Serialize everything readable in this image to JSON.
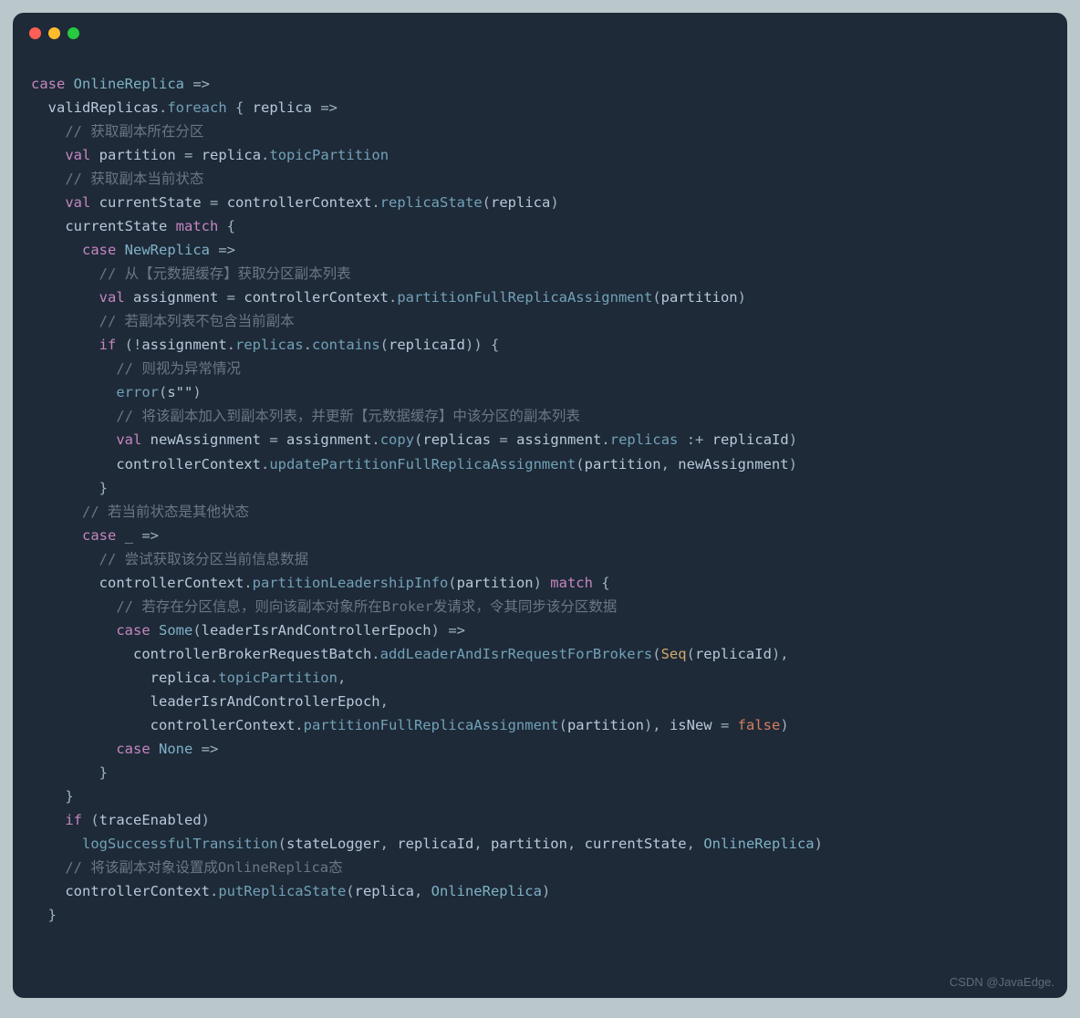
{
  "window": {
    "watermark": "CSDN @JavaEdge."
  },
  "code": {
    "lines": [
      {
        "indent": 0,
        "segments": [
          {
            "t": "case",
            "c": "keyword"
          },
          {
            "t": " ",
            "c": ""
          },
          {
            "t": "OnlineReplica",
            "c": "type"
          },
          {
            "t": " ",
            "c": ""
          },
          {
            "t": "=>",
            "c": "punct"
          }
        ]
      },
      {
        "indent": 1,
        "segments": [
          {
            "t": "validReplicas",
            "c": "ident"
          },
          {
            "t": ".",
            "c": "punct"
          },
          {
            "t": "foreach",
            "c": "method"
          },
          {
            "t": " { ",
            "c": "punct"
          },
          {
            "t": "replica",
            "c": "ident"
          },
          {
            "t": " ",
            "c": ""
          },
          {
            "t": "=>",
            "c": "punct"
          }
        ]
      },
      {
        "indent": 2,
        "segments": [
          {
            "t": "// 获取副本所在分区",
            "c": "comment"
          }
        ]
      },
      {
        "indent": 2,
        "segments": [
          {
            "t": "val",
            "c": "keyword"
          },
          {
            "t": " ",
            "c": ""
          },
          {
            "t": "partition",
            "c": "ident"
          },
          {
            "t": " ",
            "c": ""
          },
          {
            "t": "=",
            "c": "punct"
          },
          {
            "t": " ",
            "c": ""
          },
          {
            "t": "replica",
            "c": "ident"
          },
          {
            "t": ".",
            "c": "punct"
          },
          {
            "t": "topicPartition",
            "c": "method"
          }
        ]
      },
      {
        "indent": 2,
        "segments": [
          {
            "t": "// 获取副本当前状态",
            "c": "comment"
          }
        ]
      },
      {
        "indent": 2,
        "segments": [
          {
            "t": "val",
            "c": "keyword"
          },
          {
            "t": " ",
            "c": ""
          },
          {
            "t": "currentState",
            "c": "ident"
          },
          {
            "t": " ",
            "c": ""
          },
          {
            "t": "=",
            "c": "punct"
          },
          {
            "t": " ",
            "c": ""
          },
          {
            "t": "controllerContext",
            "c": "ident"
          },
          {
            "t": ".",
            "c": "punct"
          },
          {
            "t": "replicaState",
            "c": "method"
          },
          {
            "t": "(",
            "c": "punct"
          },
          {
            "t": "replica",
            "c": "ident"
          },
          {
            "t": ")",
            "c": "punct"
          }
        ]
      },
      {
        "indent": 0,
        "segments": [
          {
            "t": "",
            "c": ""
          }
        ]
      },
      {
        "indent": 2,
        "segments": [
          {
            "t": "currentState",
            "c": "ident"
          },
          {
            "t": " ",
            "c": ""
          },
          {
            "t": "match",
            "c": "keyword"
          },
          {
            "t": " {",
            "c": "punct"
          }
        ]
      },
      {
        "indent": 3,
        "segments": [
          {
            "t": "case",
            "c": "keyword"
          },
          {
            "t": " ",
            "c": ""
          },
          {
            "t": "NewReplica",
            "c": "type"
          },
          {
            "t": " ",
            "c": ""
          },
          {
            "t": "=>",
            "c": "punct"
          }
        ]
      },
      {
        "indent": 4,
        "segments": [
          {
            "t": "// 从【元数据缓存】获取分区副本列表",
            "c": "comment"
          }
        ]
      },
      {
        "indent": 4,
        "segments": [
          {
            "t": "val",
            "c": "keyword"
          },
          {
            "t": " ",
            "c": ""
          },
          {
            "t": "assignment",
            "c": "ident"
          },
          {
            "t": " ",
            "c": ""
          },
          {
            "t": "=",
            "c": "punct"
          },
          {
            "t": " ",
            "c": ""
          },
          {
            "t": "controllerContext",
            "c": "ident"
          },
          {
            "t": ".",
            "c": "punct"
          },
          {
            "t": "partitionFullReplicaAssignment",
            "c": "method"
          },
          {
            "t": "(",
            "c": "punct"
          },
          {
            "t": "partition",
            "c": "ident"
          },
          {
            "t": ")",
            "c": "punct"
          }
        ]
      },
      {
        "indent": 4,
        "segments": [
          {
            "t": "// 若副本列表不包含当前副本",
            "c": "comment"
          }
        ]
      },
      {
        "indent": 4,
        "segments": [
          {
            "t": "if",
            "c": "keyword"
          },
          {
            "t": " (!",
            "c": "punct"
          },
          {
            "t": "assignment",
            "c": "ident"
          },
          {
            "t": ".",
            "c": "punct"
          },
          {
            "t": "replicas",
            "c": "method"
          },
          {
            "t": ".",
            "c": "punct"
          },
          {
            "t": "contains",
            "c": "method"
          },
          {
            "t": "(",
            "c": "punct"
          },
          {
            "t": "replicaId",
            "c": "ident"
          },
          {
            "t": ")) {",
            "c": "punct"
          }
        ]
      },
      {
        "indent": 5,
        "segments": [
          {
            "t": "// 则视为异常情况",
            "c": "comment"
          }
        ]
      },
      {
        "indent": 5,
        "segments": [
          {
            "t": "error",
            "c": "method"
          },
          {
            "t": "(",
            "c": "punct"
          },
          {
            "t": "s\"\"",
            "c": "string"
          },
          {
            "t": ")",
            "c": "punct"
          }
        ]
      },
      {
        "indent": 5,
        "segments": [
          {
            "t": "// 将该副本加入到副本列表，并更新【元数据缓存】中该分区的副本列表",
            "c": "comment"
          }
        ]
      },
      {
        "indent": 5,
        "segments": [
          {
            "t": "val",
            "c": "keyword"
          },
          {
            "t": " ",
            "c": ""
          },
          {
            "t": "newAssignment",
            "c": "ident"
          },
          {
            "t": " ",
            "c": ""
          },
          {
            "t": "=",
            "c": "punct"
          },
          {
            "t": " ",
            "c": ""
          },
          {
            "t": "assignment",
            "c": "ident"
          },
          {
            "t": ".",
            "c": "punct"
          },
          {
            "t": "copy",
            "c": "method"
          },
          {
            "t": "(",
            "c": "punct"
          },
          {
            "t": "replicas",
            "c": "ident"
          },
          {
            "t": " ",
            "c": ""
          },
          {
            "t": "=",
            "c": "punct"
          },
          {
            "t": " ",
            "c": ""
          },
          {
            "t": "assignment",
            "c": "ident"
          },
          {
            "t": ".",
            "c": "punct"
          },
          {
            "t": "replicas",
            "c": "method"
          },
          {
            "t": " :+ ",
            "c": "punct"
          },
          {
            "t": "replicaId",
            "c": "ident"
          },
          {
            "t": ")",
            "c": "punct"
          }
        ]
      },
      {
        "indent": 5,
        "segments": [
          {
            "t": "controllerContext",
            "c": "ident"
          },
          {
            "t": ".",
            "c": "punct"
          },
          {
            "t": "updatePartitionFullReplicaAssignment",
            "c": "method"
          },
          {
            "t": "(",
            "c": "punct"
          },
          {
            "t": "partition",
            "c": "ident"
          },
          {
            "t": ", ",
            "c": "punct"
          },
          {
            "t": "newAssignment",
            "c": "ident"
          },
          {
            "t": ")",
            "c": "punct"
          }
        ]
      },
      {
        "indent": 4,
        "segments": [
          {
            "t": "}",
            "c": "punct"
          }
        ]
      },
      {
        "indent": 3,
        "segments": [
          {
            "t": "// 若当前状态是其他状态",
            "c": "comment"
          }
        ]
      },
      {
        "indent": 3,
        "segments": [
          {
            "t": "case",
            "c": "keyword"
          },
          {
            "t": " _ ",
            "c": "punct"
          },
          {
            "t": "=>",
            "c": "punct"
          }
        ]
      },
      {
        "indent": 4,
        "segments": [
          {
            "t": "// 尝试获取该分区当前信息数据",
            "c": "comment"
          }
        ]
      },
      {
        "indent": 4,
        "segments": [
          {
            "t": "controllerContext",
            "c": "ident"
          },
          {
            "t": ".",
            "c": "punct"
          },
          {
            "t": "partitionLeadershipInfo",
            "c": "method"
          },
          {
            "t": "(",
            "c": "punct"
          },
          {
            "t": "partition",
            "c": "ident"
          },
          {
            "t": ") ",
            "c": "punct"
          },
          {
            "t": "match",
            "c": "keyword"
          },
          {
            "t": " {",
            "c": "punct"
          }
        ]
      },
      {
        "indent": 5,
        "segments": [
          {
            "t": "// 若存在分区信息，则向该副本对象所在Broker发请求，令其同步该分区数据",
            "c": "comment"
          }
        ]
      },
      {
        "indent": 5,
        "segments": [
          {
            "t": "case",
            "c": "keyword"
          },
          {
            "t": " ",
            "c": ""
          },
          {
            "t": "Some",
            "c": "type"
          },
          {
            "t": "(",
            "c": "punct"
          },
          {
            "t": "leaderIsrAndControllerEpoch",
            "c": "ident"
          },
          {
            "t": ") ",
            "c": "punct"
          },
          {
            "t": "=>",
            "c": "punct"
          }
        ]
      },
      {
        "indent": 6,
        "segments": [
          {
            "t": "controllerBrokerRequestBatch",
            "c": "ident"
          },
          {
            "t": ".",
            "c": "punct"
          },
          {
            "t": "addLeaderAndIsrRequestForBrokers",
            "c": "method"
          },
          {
            "t": "(",
            "c": "punct"
          },
          {
            "t": "Seq",
            "c": "param"
          },
          {
            "t": "(",
            "c": "punct"
          },
          {
            "t": "replicaId",
            "c": "ident"
          },
          {
            "t": "),",
            "c": "punct"
          }
        ]
      },
      {
        "indent": 7,
        "segments": [
          {
            "t": "replica",
            "c": "ident"
          },
          {
            "t": ".",
            "c": "punct"
          },
          {
            "t": "topicPartition",
            "c": "method"
          },
          {
            "t": ",",
            "c": "punct"
          }
        ]
      },
      {
        "indent": 7,
        "segments": [
          {
            "t": "leaderIsrAndControllerEpoch",
            "c": "ident"
          },
          {
            "t": ",",
            "c": "punct"
          }
        ]
      },
      {
        "indent": 7,
        "segments": [
          {
            "t": "controllerContext",
            "c": "ident"
          },
          {
            "t": ".",
            "c": "punct"
          },
          {
            "t": "partitionFullReplicaAssignment",
            "c": "method"
          },
          {
            "t": "(",
            "c": "punct"
          },
          {
            "t": "partition",
            "c": "ident"
          },
          {
            "t": "), ",
            "c": "punct"
          },
          {
            "t": "isNew",
            "c": "ident"
          },
          {
            "t": " ",
            "c": ""
          },
          {
            "t": "=",
            "c": "punct"
          },
          {
            "t": " ",
            "c": ""
          },
          {
            "t": "false",
            "c": "bool"
          },
          {
            "t": ")",
            "c": "punct"
          }
        ]
      },
      {
        "indent": 5,
        "segments": [
          {
            "t": "case",
            "c": "keyword"
          },
          {
            "t": " ",
            "c": ""
          },
          {
            "t": "None",
            "c": "type"
          },
          {
            "t": " ",
            "c": ""
          },
          {
            "t": "=>",
            "c": "punct"
          }
        ]
      },
      {
        "indent": 4,
        "segments": [
          {
            "t": "}",
            "c": "punct"
          }
        ]
      },
      {
        "indent": 2,
        "segments": [
          {
            "t": "}",
            "c": "punct"
          }
        ]
      },
      {
        "indent": 2,
        "segments": [
          {
            "t": "if",
            "c": "keyword"
          },
          {
            "t": " (",
            "c": "punct"
          },
          {
            "t": "traceEnabled",
            "c": "ident"
          },
          {
            "t": ")",
            "c": "punct"
          }
        ]
      },
      {
        "indent": 3,
        "segments": [
          {
            "t": "logSuccessfulTransition",
            "c": "method"
          },
          {
            "t": "(",
            "c": "punct"
          },
          {
            "t": "stateLogger",
            "c": "ident"
          },
          {
            "t": ", ",
            "c": "punct"
          },
          {
            "t": "replicaId",
            "c": "ident"
          },
          {
            "t": ", ",
            "c": "punct"
          },
          {
            "t": "partition",
            "c": "ident"
          },
          {
            "t": ", ",
            "c": "punct"
          },
          {
            "t": "currentState",
            "c": "ident"
          },
          {
            "t": ", ",
            "c": "punct"
          },
          {
            "t": "OnlineReplica",
            "c": "type"
          },
          {
            "t": ")",
            "c": "punct"
          }
        ]
      },
      {
        "indent": 2,
        "segments": [
          {
            "t": "// 将该副本对象设置成OnlineReplica态",
            "c": "comment"
          }
        ]
      },
      {
        "indent": 2,
        "segments": [
          {
            "t": "controllerContext",
            "c": "ident"
          },
          {
            "t": ".",
            "c": "punct"
          },
          {
            "t": "putReplicaState",
            "c": "method"
          },
          {
            "t": "(",
            "c": "punct"
          },
          {
            "t": "replica",
            "c": "ident"
          },
          {
            "t": ", ",
            "c": "punct"
          },
          {
            "t": "OnlineReplica",
            "c": "type"
          },
          {
            "t": ")",
            "c": "punct"
          }
        ]
      },
      {
        "indent": 1,
        "segments": [
          {
            "t": "}",
            "c": "punct"
          }
        ]
      }
    ]
  }
}
